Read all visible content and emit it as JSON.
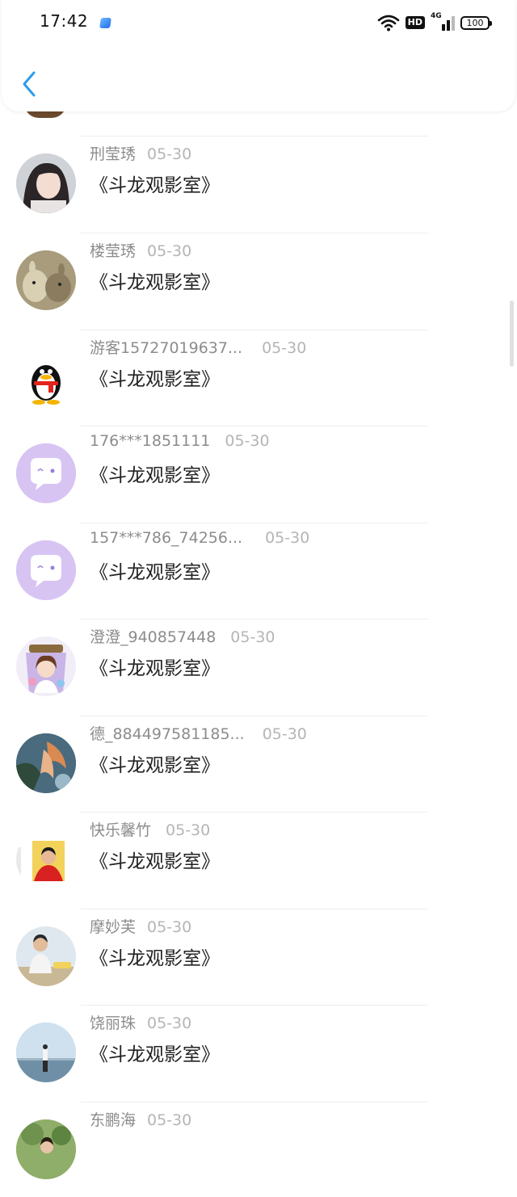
{
  "status_bar": {
    "time": "17:42",
    "hd": "HD",
    "network": "4G",
    "battery": "100"
  },
  "header": {
    "back_icon": "chevron-left-icon"
  },
  "rows": [
    {
      "name": "刑莹琇",
      "date": "05-30",
      "title": "《斗龙观影室》",
      "avatar": "photo-woman"
    },
    {
      "name": "楼莹琇",
      "date": "05-30",
      "title": "《斗龙观影室》",
      "avatar": "photo-animals"
    },
    {
      "name": "游客15727019637...",
      "date": "05-30",
      "title": "《斗龙观影室》",
      "avatar": "qq-penguin"
    },
    {
      "name": "176***1851111",
      "date": "05-30",
      "title": "《斗龙观影室》",
      "avatar": "default-chat"
    },
    {
      "name": "157***786_74256...",
      "date": "05-30",
      "title": "《斗龙观影室》",
      "avatar": "default-chat"
    },
    {
      "name": "澄澄_940857448",
      "date": "05-30",
      "title": "《斗龙观影室》",
      "avatar": "anime-girl"
    },
    {
      "name": "德_884497581185...",
      "date": "05-30",
      "title": "《斗龙观影室》",
      "avatar": "fantasy-art"
    },
    {
      "name": "快乐馨竹",
      "date": "05-30",
      "title": "《斗龙观影室》",
      "avatar": "photo-man-red"
    },
    {
      "name": "摩妙芙",
      "date": "05-30",
      "title": "《斗龙观影室》",
      "avatar": "photo-beach-man"
    },
    {
      "name": "饶丽珠",
      "date": "05-30",
      "title": "《斗龙观影室》",
      "avatar": "photo-sea"
    },
    {
      "name": "东鹏海",
      "date": "05-30",
      "title": "",
      "avatar": "photo-greenery"
    }
  ]
}
